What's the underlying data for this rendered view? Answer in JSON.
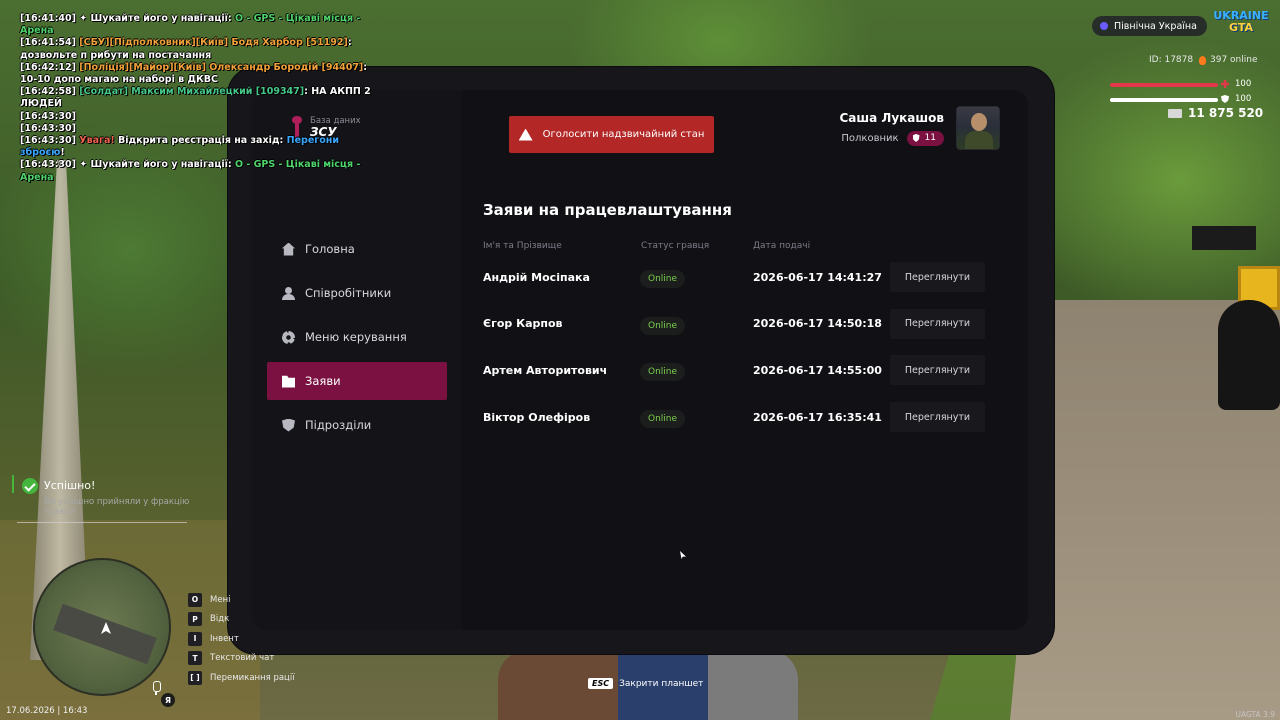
{
  "chat": [
    [
      {
        "t": "[16:41:40] ",
        "c": "white"
      },
      {
        "t": "✦ Шукайте його у навігації: ",
        "c": "white"
      },
      {
        "t": "O - GPS - Цікаві місця - Арена",
        "c": "green"
      }
    ],
    [
      {
        "t": "[16:41:54] ",
        "c": "white"
      },
      {
        "t": "[СБУ][Підполковник][Київ] Бодя Харбор [51192]",
        "c": "orange"
      },
      {
        "t": ": дозвольте п рибути на постачання",
        "c": "white"
      }
    ],
    [
      {
        "t": "[16:42:12] ",
        "c": "white"
      },
      {
        "t": "[Поліція][Майор][Київ] Олександр Бородій [94407]",
        "c": "orange"
      },
      {
        "t": ": 10-10 допо магаю на наборі в ДКВС",
        "c": "white"
      }
    ],
    [
      {
        "t": "[16:42:58] ",
        "c": "white"
      },
      {
        "t": "[Солдат] Максим Михайлецкий [109347]",
        "c": "teal"
      },
      {
        "t": ": НА АКПП 2 ЛЮДЕЙ",
        "c": "white"
      }
    ],
    [
      {
        "t": "[16:43:30]",
        "c": "white"
      }
    ],
    [
      {
        "t": "[16:43:30]",
        "c": "white"
      }
    ],
    [
      {
        "t": "[16:43:30] ",
        "c": "white"
      },
      {
        "t": "Увага! ",
        "c": "red"
      },
      {
        "t": "Відкрита реєстрація на захід: ",
        "c": "white"
      },
      {
        "t": "Перегони зброєю",
        "c": "blue"
      },
      {
        "t": "!",
        "c": "white"
      }
    ],
    [
      {
        "t": "[16:43:30] ",
        "c": "white"
      },
      {
        "t": "✦ Шукайте його у навігації: ",
        "c": "white"
      },
      {
        "t": "O - GPS - Цікаві місця - Арена",
        "c": "green"
      }
    ]
  ],
  "hud": {
    "region": "Північна Україна",
    "logo_line1": "UKRAINE",
    "logo_line2": "GTA",
    "id_text": "ID: 17878",
    "online_text": "397 online",
    "health": "100",
    "armor": "100",
    "health_level": 100,
    "armor_level": 100,
    "money": "11 875 520"
  },
  "tablet": {
    "brand_sub": "База даних",
    "brand_title": "ЗСУ",
    "alert_button": "Оголосити надзвичайний стан",
    "user_name": "Саша Лукашов",
    "user_rank": "Полковник",
    "rank_level": "11",
    "nav": [
      {
        "label": "Головна",
        "icon": "home-icon",
        "active": false
      },
      {
        "label": "Співробітники",
        "icon": "people-icon",
        "active": false
      },
      {
        "label": "Меню керування",
        "icon": "gear-icon",
        "active": false
      },
      {
        "label": "Заяви",
        "icon": "folder-icon",
        "active": true
      },
      {
        "label": "Підрозділи",
        "icon": "shield-icon",
        "active": false
      }
    ],
    "panel_title": "Заяви на працевлаштування",
    "columns": [
      "Ім'я та Прізвище",
      "Статус гравця",
      "Дата подачі"
    ],
    "rows": [
      {
        "name": "Андрій Мосіпака",
        "status": "Online",
        "date": "2026-06-17 14:41:27",
        "action": "Переглянути"
      },
      {
        "name": "Єгор Карпов",
        "status": "Online",
        "date": "2026-06-17 14:50:18",
        "action": "Переглянути"
      },
      {
        "name": "Артем Авторитович",
        "status": "Online",
        "date": "2026-06-17 14:55:00",
        "action": "Переглянути"
      },
      {
        "name": "Віктор Олефіров",
        "status": "Online",
        "date": "2026-06-17 16:35:41",
        "action": "Переглянути"
      }
    ]
  },
  "esc": {
    "key": "ESC",
    "label": "Закрити планшет"
  },
  "toast": {
    "title": "Успішно!",
    "text": "Ви успішно прийняли у фракцію гравця"
  },
  "keys": [
    {
      "key": "O",
      "label": "Мені"
    },
    {
      "key": "P",
      "label": "Відк"
    },
    {
      "key": "I",
      "label": "Інвент"
    },
    {
      "key": "T",
      "label": "Текстовий чат"
    },
    {
      "key": "[ ]",
      "label": "Перемикання рації"
    }
  ],
  "minimap_badge": "Я",
  "datetime": "17.06.2026 | 16:43",
  "build": "UAGTA 3.9",
  "colors": {
    "accent": "#7a1140",
    "alert": "#b42727",
    "online": "#7ccf4e"
  }
}
